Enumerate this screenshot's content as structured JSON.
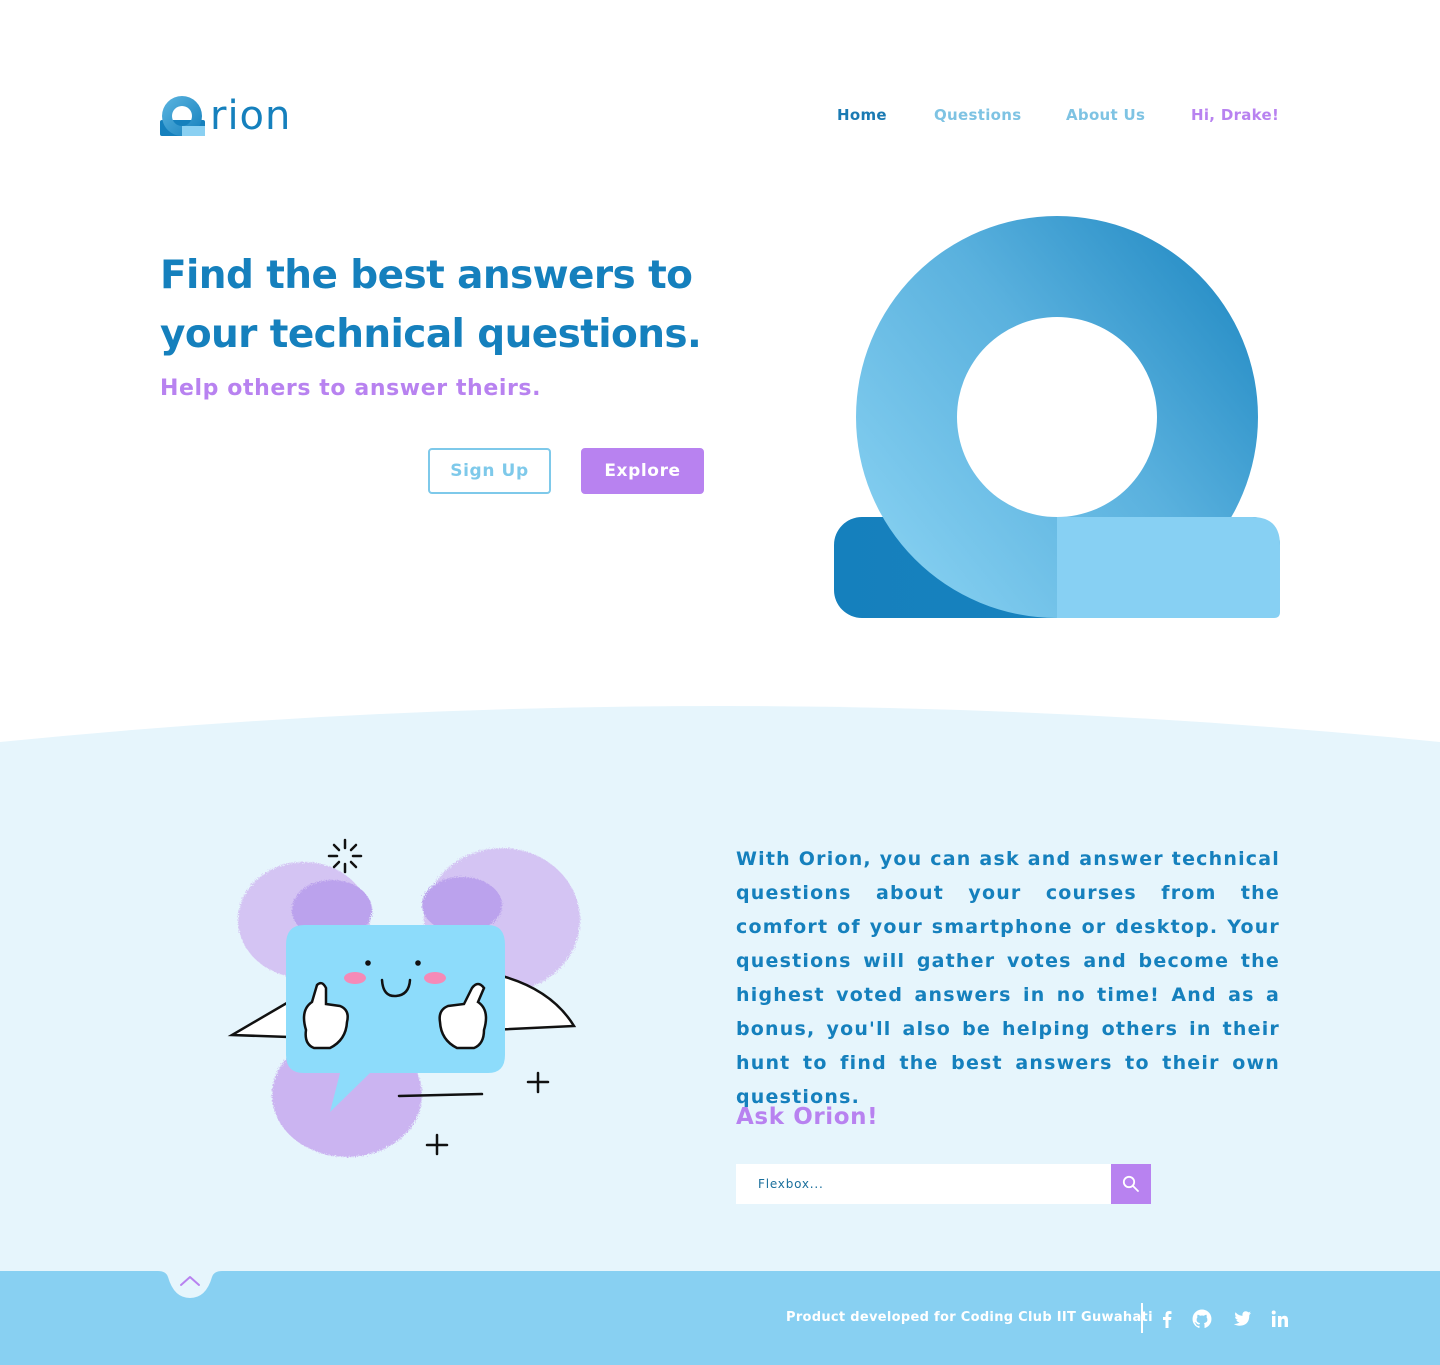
{
  "brand": {
    "name": "rion",
    "colors": {
      "primary": "#1580bd",
      "light": "#88d0f2",
      "accent": "#b882f0",
      "section_bg": "#e6f5fc"
    }
  },
  "nav": {
    "home": "Home",
    "questions": "Questions",
    "about": "About Us",
    "user": "Hi, Drake!"
  },
  "hero": {
    "title": "Find the best answers to your technical questions.",
    "subtitle": "Help others to answer theirs.",
    "signup_label": "Sign Up",
    "explore_label": "Explore"
  },
  "info": {
    "text": "With Orion, you can ask and answer technical questions about your courses from the comfort of your smartphone or desktop. Your questions will gather votes and become the highest voted answers in no time! And as a bonus, you'll also be helping others in their hunt to find the best answers to their own questions.",
    "ask_title": "Ask Orion!",
    "search_placeholder": "Flexbox..."
  },
  "footer": {
    "credit": "Product developed for Coding Club IIT Guwahati",
    "social_icons": [
      "facebook-icon",
      "github-icon",
      "twitter-icon",
      "linkedin-icon"
    ],
    "back_to_top_icon": "chevron-up-icon"
  }
}
